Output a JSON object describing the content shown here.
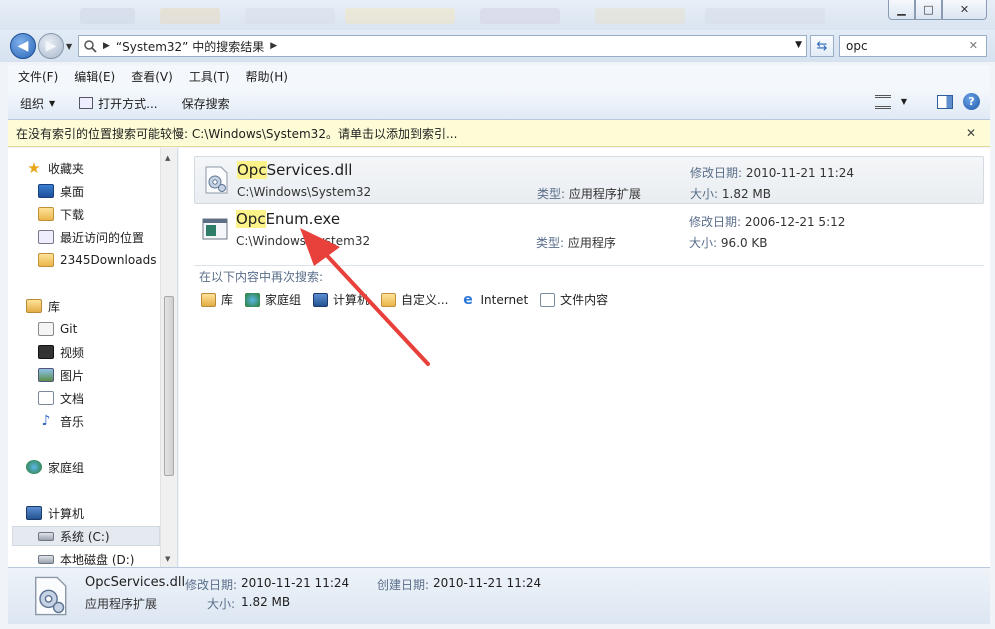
{
  "window": {
    "controls": {
      "minimize": "▁",
      "maximize": "□",
      "close": "✕"
    }
  },
  "address": {
    "path_label": "“System32” 中的搜索结果",
    "search_value": "opc"
  },
  "menu": {
    "items": [
      "文件(F)",
      "编辑(E)",
      "查看(V)",
      "工具(T)",
      "帮助(H)"
    ]
  },
  "commands": {
    "organize": "组织",
    "open_with": "打开方式...",
    "save_search": "保存搜索"
  },
  "infobar": {
    "text": "在没有索引的位置搜索可能较慢: C:\\Windows\\System32。请单击以添加到索引..."
  },
  "nav": {
    "favorites": "收藏夹",
    "desktop": "桌面",
    "downloads": "下载",
    "recent": "最近访问的位置",
    "downloads2345": "2345Downloads",
    "libraries": "库",
    "git": "Git",
    "video": "视频",
    "pictures": "图片",
    "documents": "文档",
    "music": "音乐",
    "homegroup": "家庭组",
    "computer": "计算机",
    "drive_c": "系统 (C:)",
    "drive_d": "本地磁盘 (D:)"
  },
  "results": [
    {
      "name_hl": "Opc",
      "name_rest": "Services.dll",
      "path": "C:\\Windows\\System32",
      "type_label": "类型:",
      "type": "应用程序扩展",
      "modified_label": "修改日期:",
      "modified": "2010-11-21 11:24",
      "size_label": "大小:",
      "size": "1.82 MB"
    },
    {
      "name_hl": "Opc",
      "name_rest": "Enum.exe",
      "path": "C:\\Windows\\System32",
      "type_label": "类型:",
      "type": "应用程序",
      "modified_label": "修改日期:",
      "modified": "2006-12-21 5:12",
      "size_label": "大小:",
      "size": "96.0 KB"
    }
  ],
  "search_again": {
    "label": "在以下内容中再次搜索:",
    "items": [
      "库",
      "家庭组",
      "计算机",
      "自定义...",
      "Internet",
      "文件内容"
    ]
  },
  "details": {
    "name": "OpcServices.dll",
    "type": "应用程序扩展",
    "modified_label": "修改日期:",
    "modified": "2010-11-21 11:24",
    "size_label": "大小:",
    "size": "1.82 MB",
    "created_label": "创建日期:",
    "created": "2010-11-21 11:24"
  },
  "colors": {
    "highlight": "#fbf38a",
    "arrow": "#e8403a",
    "infobar": "#fefcd6"
  }
}
